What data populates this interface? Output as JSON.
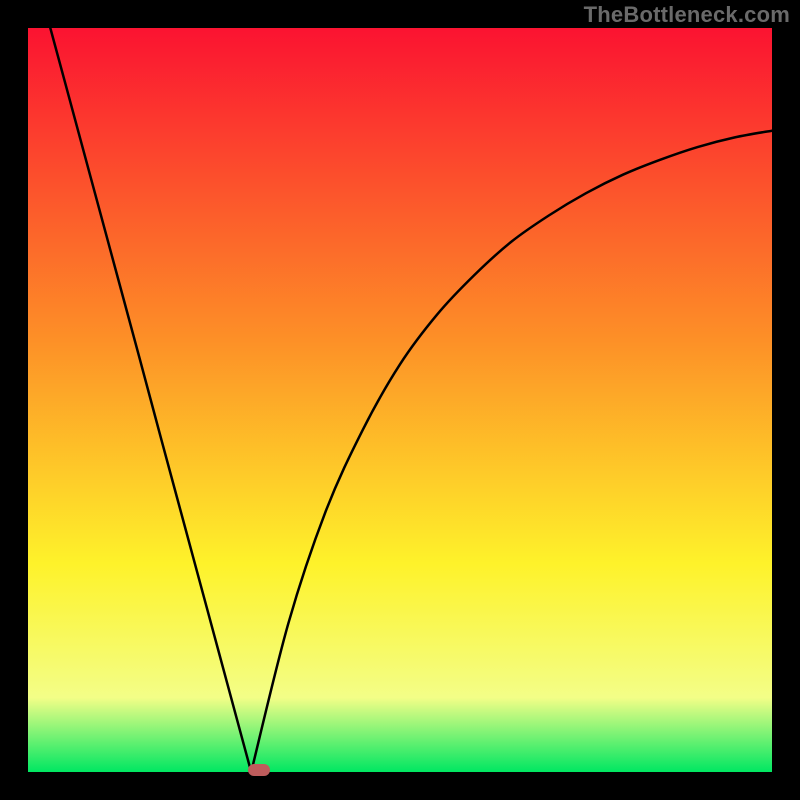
{
  "watermark": "TheBottleneck.com",
  "colors": {
    "frame": "#000000",
    "curve": "#000000",
    "gradient_top": "#fb1331",
    "gradient_mid1": "#fd9027",
    "gradient_mid2": "#fef22a",
    "gradient_near_bottom": "#f3fe87",
    "gradient_bottom": "#00e762",
    "marker": "#be5c5c"
  },
  "chart_data": {
    "type": "line",
    "title": "",
    "xlabel": "",
    "ylabel": "",
    "xlim": [
      0,
      1
    ],
    "ylim": [
      0,
      1
    ],
    "legend": null,
    "annotations": [],
    "min_x": 0.3,
    "min_y": 0.0,
    "marker": {
      "x": 0.31,
      "y": 0.0
    },
    "series": [
      {
        "name": "left-branch",
        "x": [
          0.03,
          0.06,
          0.09,
          0.12,
          0.15,
          0.18,
          0.21,
          0.24,
          0.27,
          0.3
        ],
        "values": [
          1.0,
          0.889,
          0.778,
          0.667,
          0.556,
          0.444,
          0.333,
          0.222,
          0.111,
          0.0
        ]
      },
      {
        "name": "right-branch",
        "x": [
          0.3,
          0.35,
          0.4,
          0.45,
          0.5,
          0.55,
          0.6,
          0.65,
          0.7,
          0.75,
          0.8,
          0.85,
          0.9,
          0.95,
          1.0
        ],
        "values": [
          0.0,
          0.2,
          0.35,
          0.46,
          0.548,
          0.615,
          0.668,
          0.713,
          0.748,
          0.778,
          0.803,
          0.823,
          0.84,
          0.853,
          0.862
        ]
      }
    ]
  }
}
